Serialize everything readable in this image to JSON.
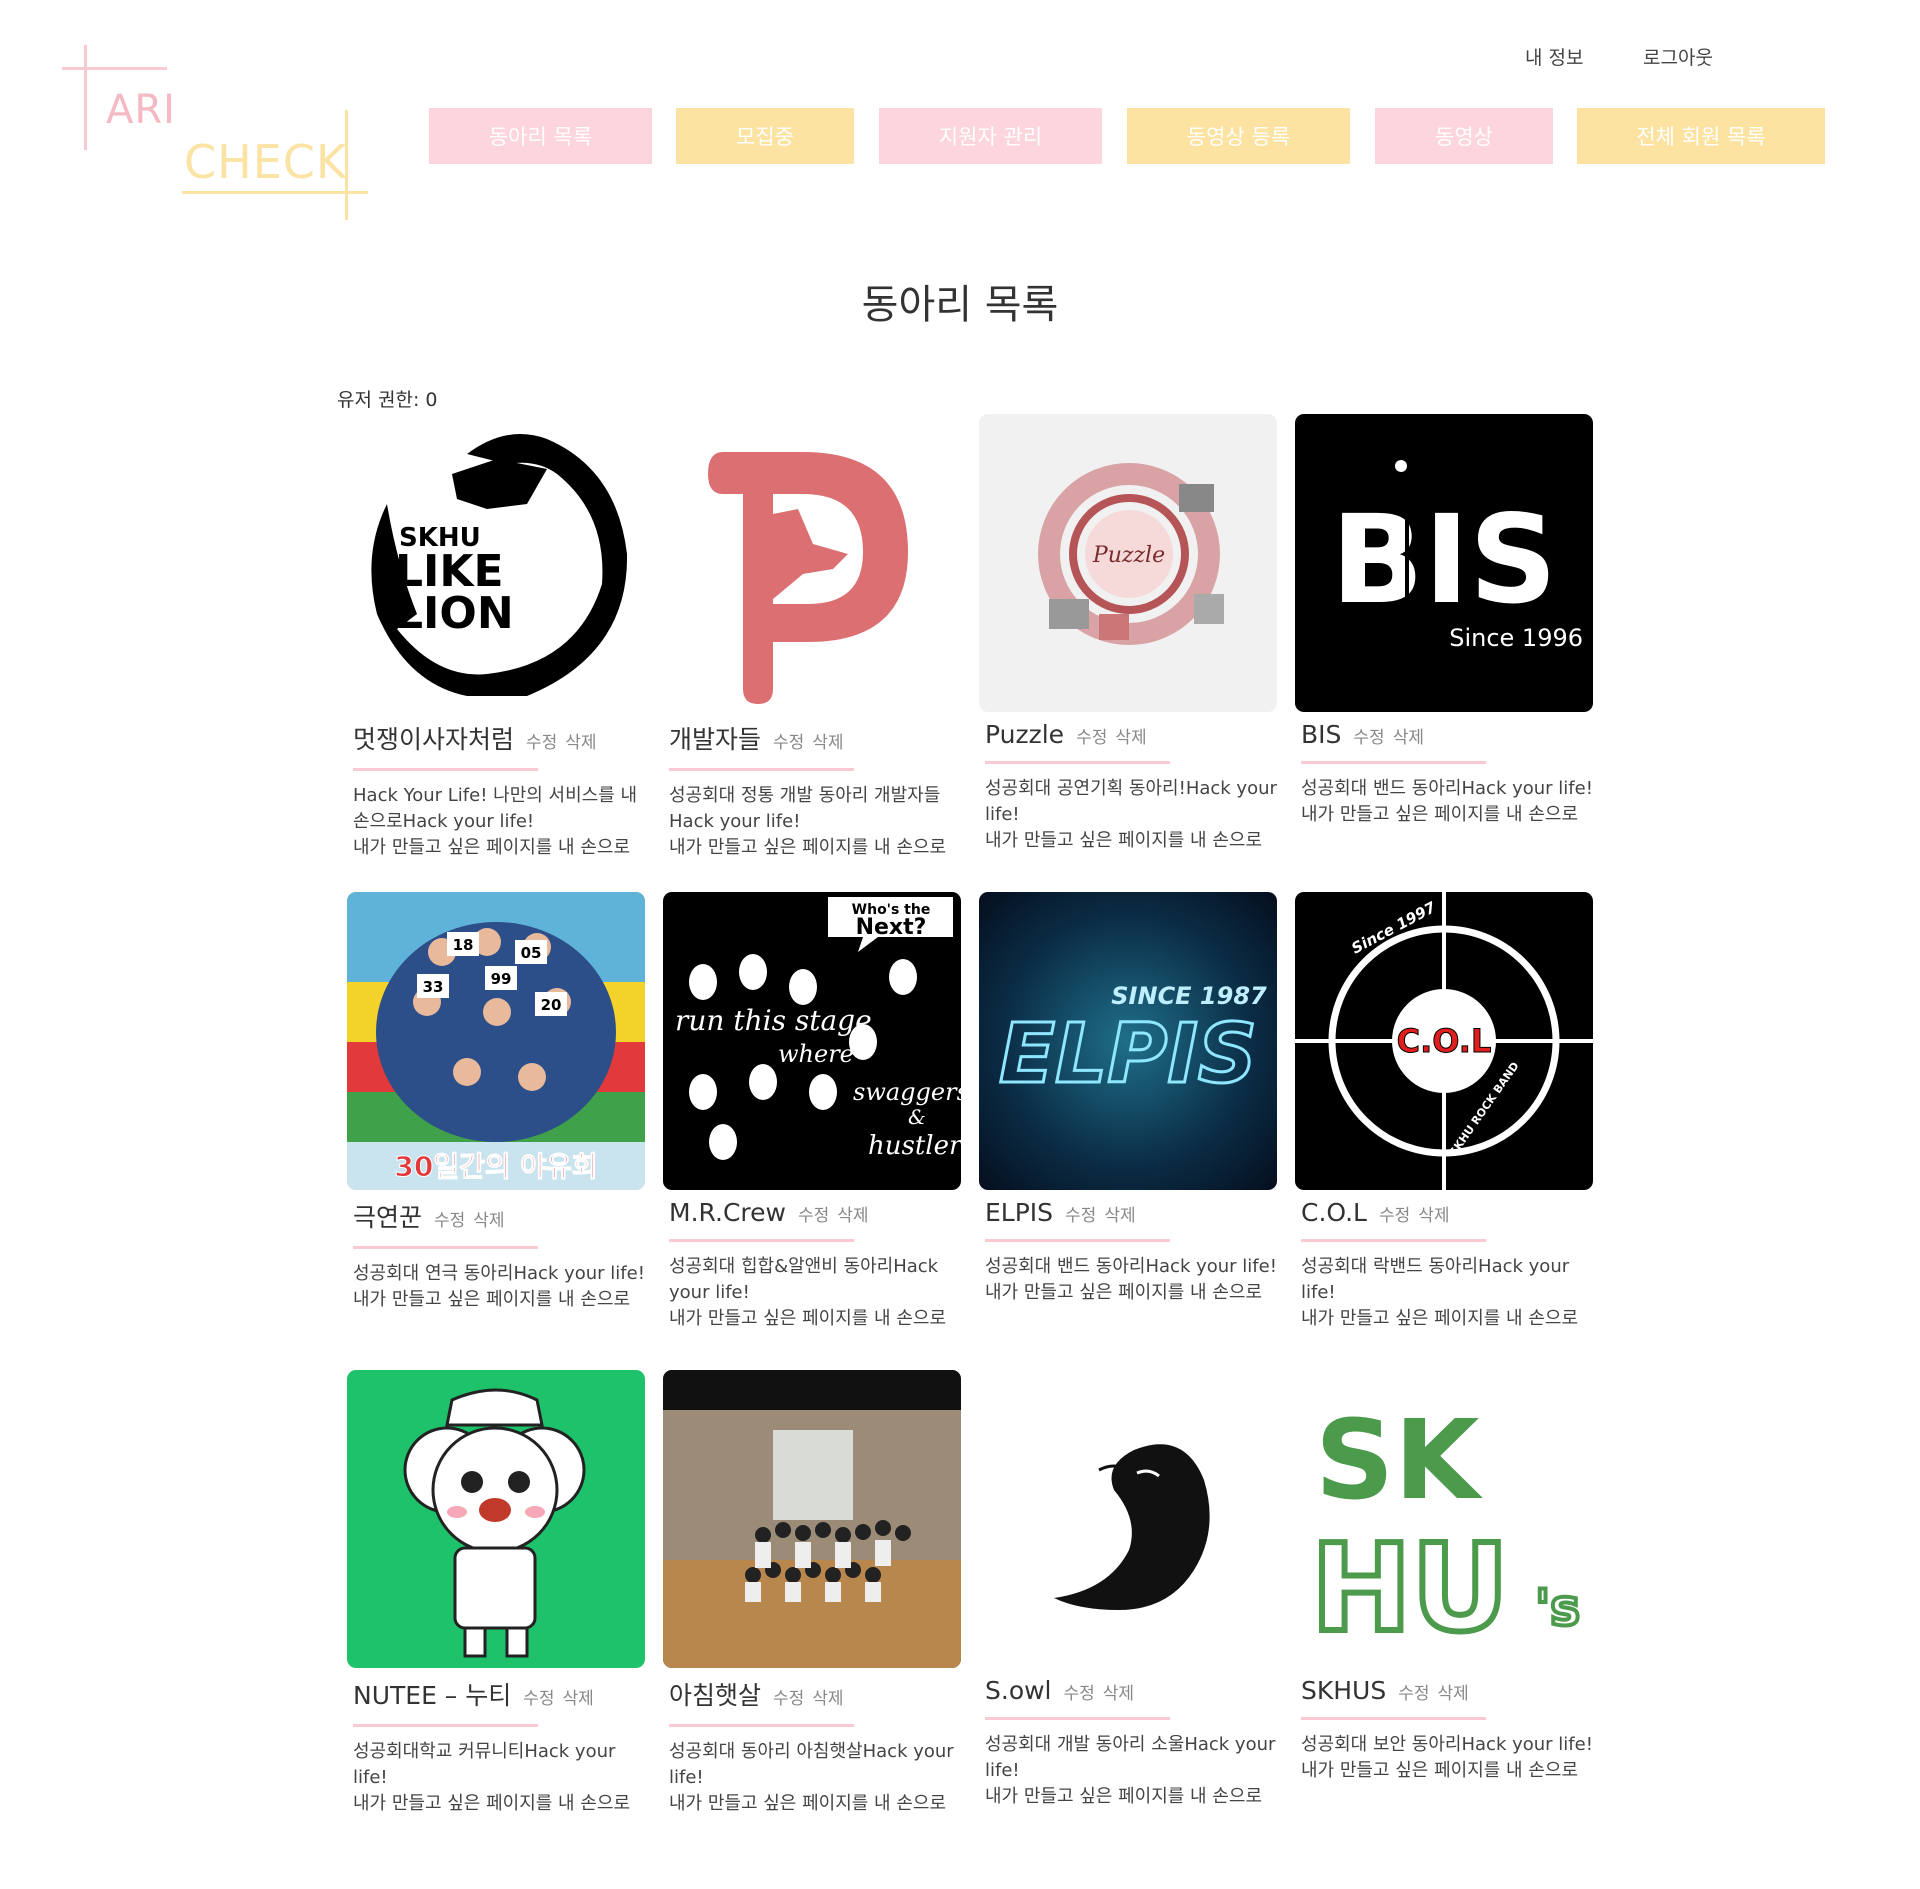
{
  "logo": {
    "line1": "ARI",
    "line2": "CHECK"
  },
  "header": {
    "my_info": "내 정보",
    "logout": "로그아웃"
  },
  "nav": [
    {
      "label": "동아리 목록",
      "color": "#fdd5dc"
    },
    {
      "label": "모집중",
      "color": "#fce3a1"
    },
    {
      "label": "지원자 관리",
      "color": "#fdd5dc"
    },
    {
      "label": "동영상 등록",
      "color": "#fce3a1"
    },
    {
      "label": "동영상",
      "color": "#fdd5dc"
    },
    {
      "label": "전체 회원 목록",
      "color": "#fce3a1"
    }
  ],
  "page_title": "동아리 목록",
  "permission_text": "유저 권한: 0",
  "actions": {
    "edit": "수정",
    "delete": "삭제"
  },
  "clubs": [
    {
      "name": "멋쟁이사자처럼",
      "desc1": "Hack Your Life! 나만의 서비스를 내손으로Hack your life!",
      "desc2": "내가 만들고 싶은 페이지를 내 손으로",
      "image": "lion-logo",
      "logo_text": [
        "SKHU",
        "LIKE",
        "LION"
      ]
    },
    {
      "name": "개발자들",
      "desc1": "성공회대 정통 개발 동아리 개발자들 Hack your life!",
      "desc2": "내가 만들고 싶은 페이지를 내 손으로",
      "image": "dog-d-logo"
    },
    {
      "name": "Puzzle",
      "desc1": "성공회대 공연기획 동아리!Hack your life!",
      "desc2": "내가 만들고 싶은 페이지를 내 손으로",
      "image": "puzzle-logo",
      "logo_text": [
        "Puzzle"
      ]
    },
    {
      "name": "BIS",
      "desc1": "성공회대 밴드 동아리Hack your life!",
      "desc2": "내가 만들고 싶은 페이지를 내 손으로",
      "image": "bis-logo",
      "logo_text": [
        "BIS",
        "Since 1996"
      ]
    },
    {
      "name": "극연꾼",
      "desc1": "성공회대 연극 동아리Hack your life!",
      "desc2": "내가 만들고 싶은 페이지를 내 손으로",
      "image": "theater-poster",
      "logo_text": [
        "18",
        "05",
        "33",
        "99",
        "20",
        "30일간의 야유회"
      ]
    },
    {
      "name": "M.R.Crew",
      "desc1": "성공회대 힙합&알앤비 동아리Hack your life!",
      "desc2": "내가 만들고 싶은 페이지를 내 손으로",
      "image": "hiphop-poster",
      "logo_text": [
        "Who's the",
        "Next?",
        "run this stage",
        "where",
        "swaggers",
        "&",
        "hustlers"
      ]
    },
    {
      "name": "ELPIS",
      "desc1": "성공회대 밴드 동아리Hack your life!",
      "desc2": "내가 만들고 싶은 페이지를 내 손으로",
      "image": "elpis-logo",
      "logo_text": [
        "SINCE 1987",
        "ELPIS"
      ]
    },
    {
      "name": "C.O.L",
      "desc1": "성공회대 락밴드 동아리Hack your life!",
      "desc2": "내가 만들고 싶은 페이지를 내 손으로",
      "image": "col-logo",
      "logo_text": [
        "Since 1997",
        "C.O.L",
        "SKHU ROCK BAND"
      ]
    },
    {
      "name": "NUTEE – 누티",
      "desc1": "성공회대학교 커뮤니티Hack your life!",
      "desc2": "내가 만들고 싶은 페이지를 내 손으로",
      "image": "nutee-mascot"
    },
    {
      "name": "아침햇살",
      "desc1": "성공회대 동아리 아침햇살Hack your life!",
      "desc2": "내가 만들고 싶은 페이지를 내 손으로",
      "image": "group-photo"
    },
    {
      "name": "S.owl",
      "desc1": "성공회대 개발 동아리 소울Hack your life!",
      "desc2": "내가 만들고 싶은 페이지를 내 손으로",
      "image": "owl-logo"
    },
    {
      "name": "SKHUS",
      "desc1": "성공회대 보안 동아리Hack your life!",
      "desc2": "내가 만들고 싶은 페이지를 내 손으로",
      "image": "skhus-logo",
      "logo_text": [
        "SK",
        "HU",
        "'s"
      ]
    }
  ]
}
